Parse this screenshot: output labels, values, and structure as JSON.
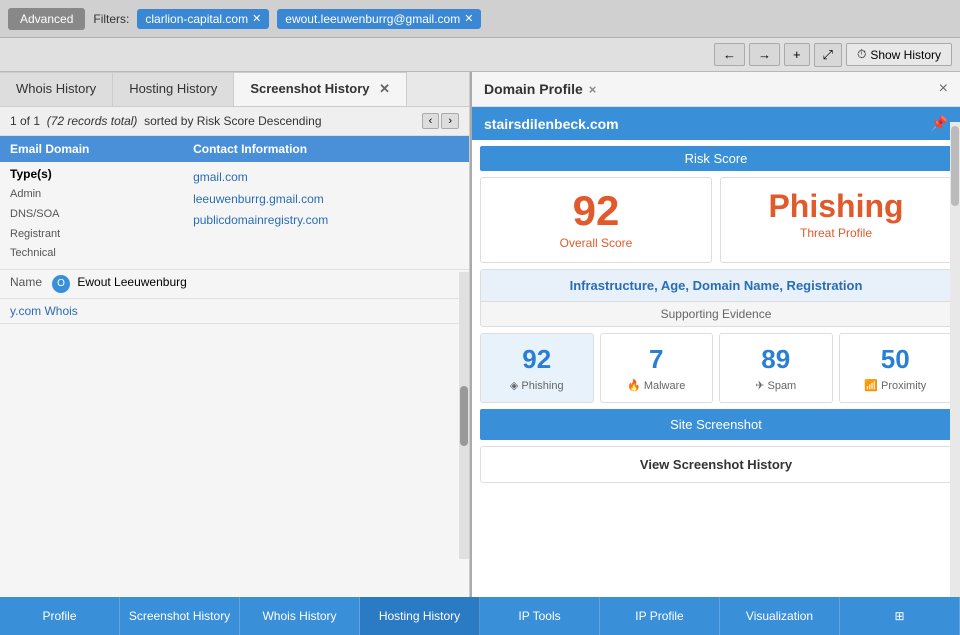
{
  "topbar": {
    "advanced_label": "Advanced",
    "filters_label": "Filters:",
    "filter1": "clarlion-capital.com",
    "filter2": "ewout.leeuwenburrg@gmail.com"
  },
  "secondbar": {
    "nav_left": "←",
    "nav_right": "→",
    "nav_plus": "+",
    "nav_expand": "⤢",
    "show_history_icon": "⏱",
    "show_history_label": "Show History"
  },
  "left_panel": {
    "tabs": [
      {
        "label": "Whois History",
        "active": false
      },
      {
        "label": "Hosting History",
        "active": false
      },
      {
        "label": "Screenshot History",
        "active": false
      }
    ],
    "records_text": "1 of 1",
    "records_italic": "(72 records total)",
    "sorted_text": "sorted by Risk Score Descending",
    "columns": [
      "Email Domain",
      "Contact Information"
    ],
    "rows": [
      {
        "types": [
          "Type(s)",
          "Admin",
          "DNS/SOA",
          "Registrant",
          "Technical"
        ],
        "domains": [
          "gmail.com",
          "leeuwenburrg.gmail.com",
          "publicdomainregistry.com"
        ],
        "name_label": "Name",
        "name_value": "Ewout Leeuwenburg",
        "initial": "O"
      }
    ],
    "whois_label": "y.com Whois"
  },
  "domain_profile": {
    "title": "Domain Profile",
    "close_label": "×",
    "domain_name": "stairsdilenbeck.com",
    "pin_icon": "📌",
    "risk_score_header": "Risk Score",
    "overall_score_number": "92",
    "overall_score_label": "Overall Score",
    "threat_text": "Phishing",
    "threat_label": "Threat Profile",
    "evidence_title": "Infrastructure, Age, Domain Name, Registration",
    "evidence_sub": "Supporting Evidence",
    "scores": [
      {
        "number": "92",
        "label": "Phishing",
        "icon": "◈",
        "active": true
      },
      {
        "number": "7",
        "label": "Malware",
        "icon": "🔥"
      },
      {
        "number": "89",
        "label": "Spam",
        "icon": "✈"
      },
      {
        "number": "50",
        "label": "Proximity",
        "icon": "📶"
      }
    ],
    "screenshot_bar": "Site Screenshot",
    "view_screenshot": "View Screenshot History"
  },
  "bottom_tabs": [
    {
      "label": "Profile",
      "active": false
    },
    {
      "label": "Screenshot History",
      "active": false
    },
    {
      "label": "Whois History",
      "active": false
    },
    {
      "label": "Hosting History",
      "active": false
    },
    {
      "label": "IP Tools",
      "active": false
    },
    {
      "label": "IP Profile",
      "active": false
    },
    {
      "label": "Visualization",
      "active": false
    },
    {
      "label": "⊞",
      "is_grid": true
    }
  ]
}
